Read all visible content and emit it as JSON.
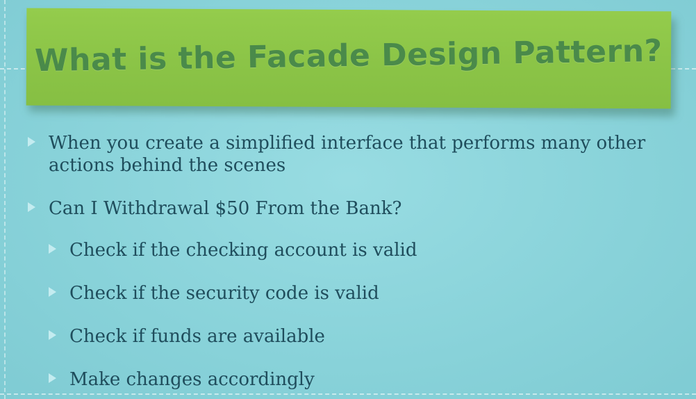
{
  "slide": {
    "title": "What is the Facade Design Pattern?",
    "bullets": [
      {
        "level": 1,
        "text": "When you create a simplified interface that performs many other actions behind the scenes"
      },
      {
        "level": 1,
        "text": "Can I Withdrawal $50 From the Bank?"
      },
      {
        "level": 2,
        "text": "Check if the checking account is valid"
      },
      {
        "level": 2,
        "text": "Check if the security code is valid"
      },
      {
        "level": 2,
        "text": "Check if funds are available"
      },
      {
        "level": 2,
        "text": "Make changes accordingly"
      }
    ]
  },
  "icons": {
    "bullet": "triangle-right-icon"
  },
  "colors": {
    "background": "#8ad4db",
    "banner": "#8bc447",
    "title_text": "#4a8a4a",
    "body_text": "#1f4d5c",
    "bullet_arrow": "#c4ecf0"
  }
}
